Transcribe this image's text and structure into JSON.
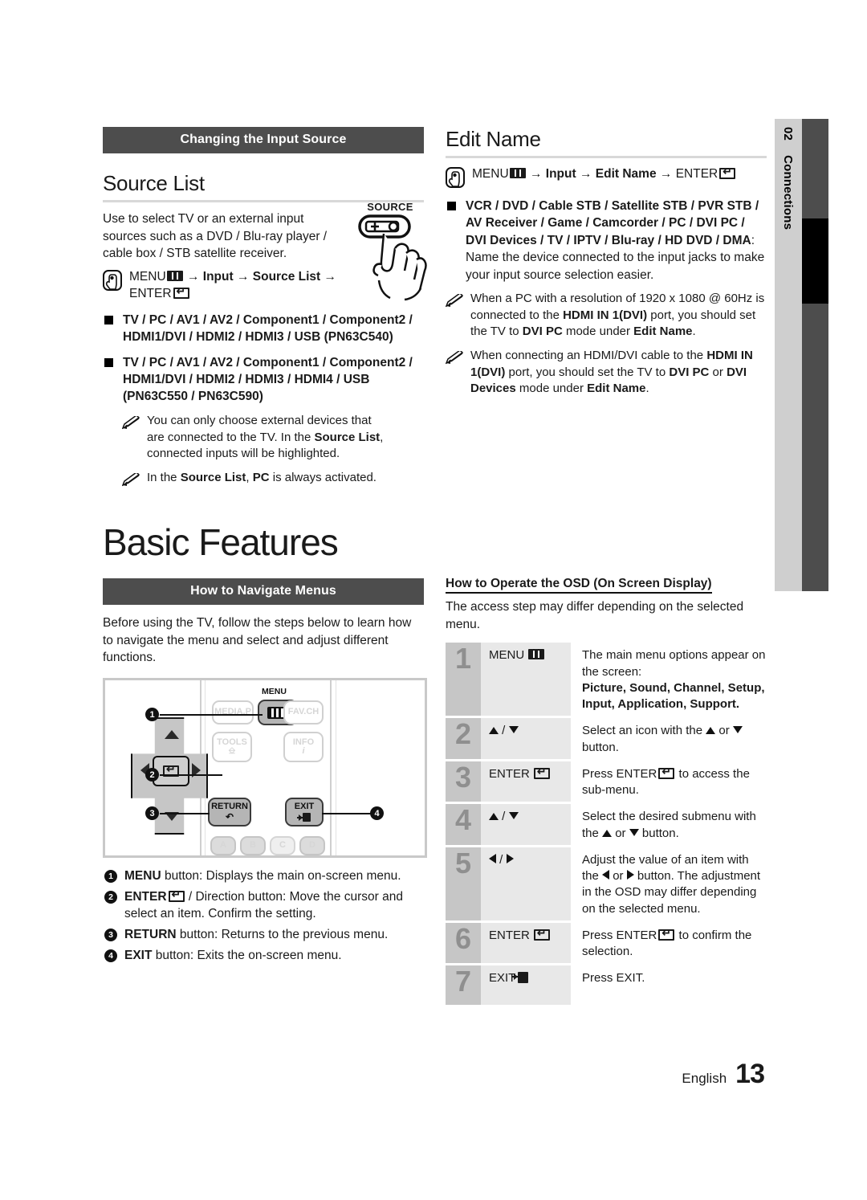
{
  "page": {
    "language_label": "English",
    "page_number": "13"
  },
  "side_tab": {
    "number": "02",
    "label": "Connections"
  },
  "left_column": {
    "section_bar": "Changing the Input Source",
    "heading": "Source List",
    "intro": "Use to select TV or an external input sources such as a DVD / Blu-ray player / cable box / STB satellite receiver.",
    "path": {
      "menu": "MENU",
      "sep": "→",
      "step1": "Input",
      "step2": "Source List",
      "enter": "ENTER"
    },
    "bullets": [
      {
        "bold": "TV / PC / AV1 / AV2 / Component1 / Component2 / HDMI1/DVI / HDMI2 / HDMI3 / USB (PN63C540)"
      },
      {
        "bold": "TV / PC / AV1 / AV2 / Component1 / Component2 / HDMI1/DVI / HDMI2 / HDMI3 / HDMI4 / USB (PN63C550 / PN63C590)"
      }
    ],
    "notes": [
      {
        "pre": "You can only choose external devices that are connected to the TV. In the ",
        "b1": "Source List",
        "post": ", connected inputs will be highlighted."
      },
      {
        "pre": "In the ",
        "b1": "Source List",
        "mid": ", ",
        "b2": "PC",
        "post": " is always activated."
      }
    ],
    "source_button_label": "SOURCE"
  },
  "right_column": {
    "heading": "Edit Name",
    "path": {
      "menu": "MENU",
      "sep": "→",
      "step1": "Input",
      "step2": "Edit Name",
      "enter": "ENTER"
    },
    "bullet": {
      "bold": "VCR / DVD / Cable STB / Satellite STB / PVR STB / AV Receiver / Game / Camcorder / PC / DVI PC / DVI Devices / TV / IPTV / Blu-ray / HD DVD / DMA",
      "regular": ": Name the device connected to the input jacks to make your input source selection easier."
    },
    "notes": [
      {
        "p1": "When a PC with a resolution of 1920 x 1080 @ 60Hz is connected to the ",
        "b1": "HDMI IN 1(DVI)",
        "p2": " port, you should set the TV to ",
        "b2": "DVI PC",
        "p3": " mode under ",
        "b3": "Edit Name",
        "p4": "."
      },
      {
        "p1": "When connecting an HDMI/DVI cable to the ",
        "b1": "HDMI IN 1(DVI)",
        "p2": " port, you should set the TV to ",
        "b2": "DVI PC",
        "p3": " or ",
        "b3": "DVI Devices",
        "p4": " mode under ",
        "b4": "Edit Name",
        "p5": "."
      }
    ]
  },
  "basic_features": {
    "title": "Basic Features",
    "section_bar": "How to Navigate Menus",
    "intro": "Before using the TV, follow the steps below to learn how to navigate the menu and select and adjust different functions.",
    "remote": {
      "buttons": {
        "media_p": "MEDIA.P",
        "menu_label": "MENU",
        "fav_ch": "FAV.CH",
        "tools": "TOOLS",
        "info": "INFO",
        "return": "RETURN",
        "exit": "EXIT",
        "color_a": "A",
        "color_b": "B",
        "color_c": "C",
        "color_d": "D"
      },
      "callouts": [
        "1",
        "2",
        "3",
        "4"
      ]
    },
    "legend": [
      {
        "n": "1",
        "b": "MENU",
        "t": " button: Displays the main on-screen menu."
      },
      {
        "n": "2",
        "b": "ENTER",
        "t": " / Direction button: Move the cursor and select an item. Confirm the setting."
      },
      {
        "n": "3",
        "b": "RETURN",
        "t": " button: Returns to the previous menu."
      },
      {
        "n": "4",
        "b": "EXIT",
        "t": " button: Exits the on-screen menu."
      }
    ]
  },
  "osd": {
    "subhead": "How to Operate the OSD (On Screen Display)",
    "intro": "The access step may differ depending on the selected menu.",
    "rows": [
      {
        "num": "1",
        "key": "MENU",
        "key_icon": "menu-glyph",
        "desc_pre": "The main menu options appear on the screen:",
        "desc_bold": "Picture, Sound, Channel, Setup, Input, Application, Support."
      },
      {
        "num": "2",
        "key": "▲ / ▼",
        "key_icon": "updown-arrows",
        "desc_pre": "Select an icon with the ▲ or ▼ button."
      },
      {
        "num": "3",
        "key": "ENTER",
        "key_icon": "enter-glyph",
        "desc_pre": "Press ENTER",
        "desc_post": " to access the sub-menu."
      },
      {
        "num": "4",
        "key": "▲ / ▼",
        "key_icon": "updown-arrows",
        "desc_pre": "Select the desired submenu with the ▲ or ▼ button."
      },
      {
        "num": "5",
        "key": "◄ / ►",
        "key_icon": "leftright-arrows",
        "desc_pre": "Adjust the value of an item with the ◄ or ► button. The adjustment in the OSD may differ depending on the selected menu."
      },
      {
        "num": "6",
        "key": "ENTER",
        "key_icon": "enter-glyph",
        "desc_pre": "Press ENTER",
        "desc_post": " to confirm the selection."
      },
      {
        "num": "7",
        "key": "EXIT",
        "key_icon": "exit-glyph",
        "desc_pre": "Press ",
        "desc_bold": "EXIT",
        "desc_post": "."
      }
    ]
  },
  "colors": {
    "bar_dark": "#4d4d4d",
    "side_tab": "#cfcfcf",
    "rule": "#d8d8d8",
    "osd_num_bg": "#c6c6c6",
    "osd_key_bg": "#e8e8e8"
  }
}
